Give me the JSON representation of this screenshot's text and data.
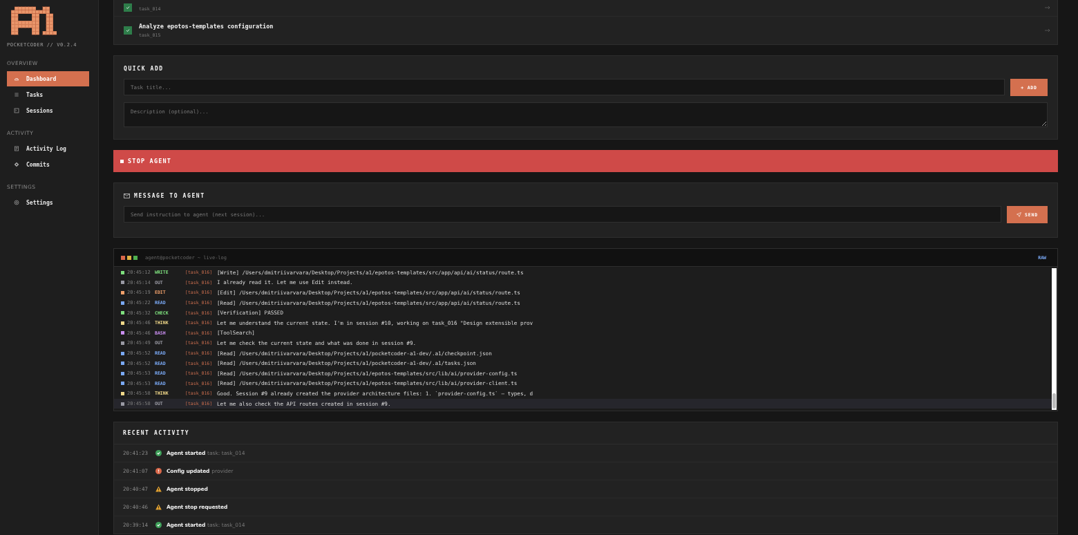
{
  "sidebar": {
    "version": "POCKETCODER // V0.2.4",
    "sections": [
      {
        "title": "OVERVIEW",
        "items": [
          {
            "label": "Dashboard",
            "selected": true
          },
          {
            "label": "Tasks",
            "selected": false
          },
          {
            "label": "Sessions",
            "selected": false
          }
        ]
      },
      {
        "title": "ACTIVITY",
        "items": [
          {
            "label": "Activity Log",
            "selected": false
          },
          {
            "label": "Commits",
            "selected": false
          }
        ]
      },
      {
        "title": "SETTINGS",
        "items": [
          {
            "label": "Settings",
            "selected": false
          }
        ]
      }
    ]
  },
  "tasks": [
    {
      "id": "task_014",
      "done": true
    },
    {
      "title": "Analyze epotos-templates configuration",
      "id": "task_015",
      "done": true
    }
  ],
  "quick_add": {
    "title": "QUICK ADD",
    "title_placeholder": "Task title...",
    "add_button": "+ ADD",
    "description_placeholder": "Description (optional)..."
  },
  "stop_button": "STOP AGENT",
  "message": {
    "title": "MESSAGE TO AGENT",
    "placeholder": "Send instruction to agent (next session)...",
    "send_button": "SEND"
  },
  "live_log": {
    "title": "agent@pocketcoder ~ live-log",
    "raw_button": "RAW",
    "rows": [
      {
        "time": "20:45:12",
        "kind": "WRITE",
        "task": "[task_016]",
        "text": "[Write] /Users/dmitriivarvara/Desktop/Projects/a1/epotos-templates/src/app/api/ai/status/route.ts",
        "selected": false
      },
      {
        "time": "20:45:14",
        "kind": "OUT",
        "task": "[task_016]",
        "text": "I already read it. Let me use Edit instead.",
        "selected": false
      },
      {
        "time": "20:45:19",
        "kind": "EDIT",
        "task": "[task_016]",
        "text": "[Edit] /Users/dmitriivarvara/Desktop/Projects/a1/epotos-templates/src/app/api/ai/status/route.ts",
        "selected": false
      },
      {
        "time": "20:45:22",
        "kind": "READ",
        "task": "[task_016]",
        "text": "[Read] /Users/dmitriivarvara/Desktop/Projects/a1/epotos-templates/src/app/api/ai/status/route.ts",
        "selected": false
      },
      {
        "time": "20:45:32",
        "kind": "CHECK",
        "task": "[task_016]",
        "text": "[Verification] PASSED",
        "selected": false
      },
      {
        "time": "20:45:46",
        "kind": "THINK",
        "task": "[task_016]",
        "text": "Let me understand the current state. I'm in session #10, working on task_016 \"Design extensible prov",
        "selected": false
      },
      {
        "time": "20:45:46",
        "kind": "BASH",
        "task": "[task_016]",
        "text": "[ToolSearch]",
        "selected": false
      },
      {
        "time": "20:45:49",
        "kind": "OUT",
        "task": "[task_016]",
        "text": "Let me check the current state and what was done in session #9.",
        "selected": false
      },
      {
        "time": "20:45:52",
        "kind": "READ",
        "task": "[task_016]",
        "text": "[Read] /Users/dmitriivarvara/Desktop/Projects/a1/pocketcoder-a1-dev/.a1/checkpoint.json",
        "selected": false
      },
      {
        "time": "20:45:52",
        "kind": "READ",
        "task": "[task_016]",
        "text": "[Read] /Users/dmitriivarvara/Desktop/Projects/a1/pocketcoder-a1-dev/.a1/tasks.json",
        "selected": false
      },
      {
        "time": "20:45:53",
        "kind": "READ",
        "task": "[task_016]",
        "text": "[Read] /Users/dmitriivarvara/Desktop/Projects/a1/epotos-templates/src/lib/ai/provider-config.ts",
        "selected": false
      },
      {
        "time": "20:45:53",
        "kind": "READ",
        "task": "[task_016]",
        "text": "[Read] /Users/dmitriivarvara/Desktop/Projects/a1/epotos-templates/src/lib/ai/provider-client.ts",
        "selected": false
      },
      {
        "time": "20:45:58",
        "kind": "THINK",
        "task": "[task_016]",
        "text": "Good. Session #9 already created the provider architecture files: 1. `provider-config.ts` — types, d",
        "selected": false
      },
      {
        "time": "20:45:58",
        "kind": "OUT",
        "task": "[task_016]",
        "text": "Let me also check the API routes created in session #9.",
        "selected": true
      }
    ]
  },
  "recent_activity": {
    "title": "RECENT ACTIVITY",
    "items": [
      {
        "time": "20:41:23",
        "kind": "success",
        "event": "Agent started",
        "detail": "task: task_014"
      },
      {
        "time": "20:41:07",
        "kind": "error",
        "event": "Config updated",
        "detail": "provider"
      },
      {
        "time": "20:40:47",
        "kind": "warning",
        "event": "Agent stopped"
      },
      {
        "time": "20:40:46",
        "kind": "warning",
        "event": "Agent stop requested"
      },
      {
        "time": "20:39:14",
        "kind": "success",
        "event": "Agent started",
        "detail": "task: task_014"
      }
    ]
  }
}
